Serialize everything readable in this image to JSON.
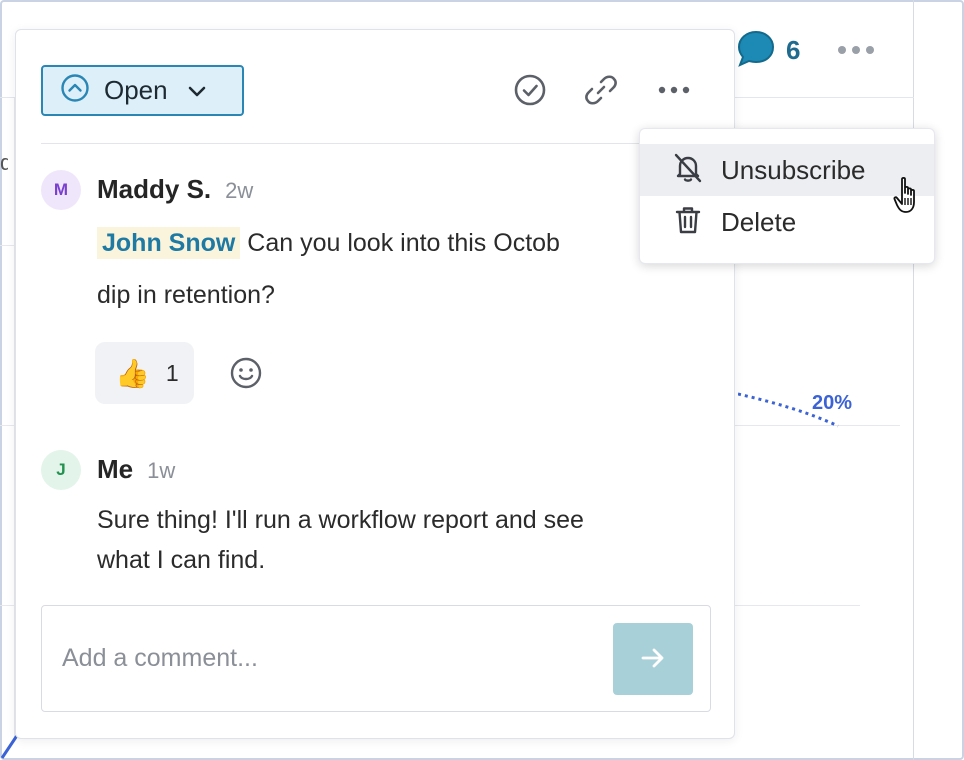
{
  "background": {
    "comment_count": "6",
    "chart_annotation": "20%"
  },
  "header": {
    "status_label": "Open"
  },
  "comments": [
    {
      "avatar_initial": "M",
      "author": "Maddy S.",
      "age": "2w",
      "mention": "John Snow",
      "text_line1": "Can you look into this Octob",
      "text_line2": "dip in retention?",
      "reaction_emoji": "👍",
      "reaction_count": "1"
    },
    {
      "avatar_initial": "J",
      "author": "Me",
      "age": "1w",
      "text_line1": "Sure thing! I'll run a workflow report and see",
      "text_line2": "what I can find."
    }
  ],
  "composer": {
    "placeholder": "Add a comment..."
  },
  "menu": {
    "items": [
      {
        "label": "Unsubscribe",
        "icon": "bell-off-icon"
      },
      {
        "label": "Delete",
        "icon": "trash-icon"
      }
    ]
  },
  "colors": {
    "accent": "#2a86b5",
    "status_bg": "#ddf0f9",
    "mention_text": "#1f7aa3",
    "mention_bg": "#fbf4dd",
    "send_button": "#a7d0d9",
    "chart_line": "#3b63d6"
  }
}
